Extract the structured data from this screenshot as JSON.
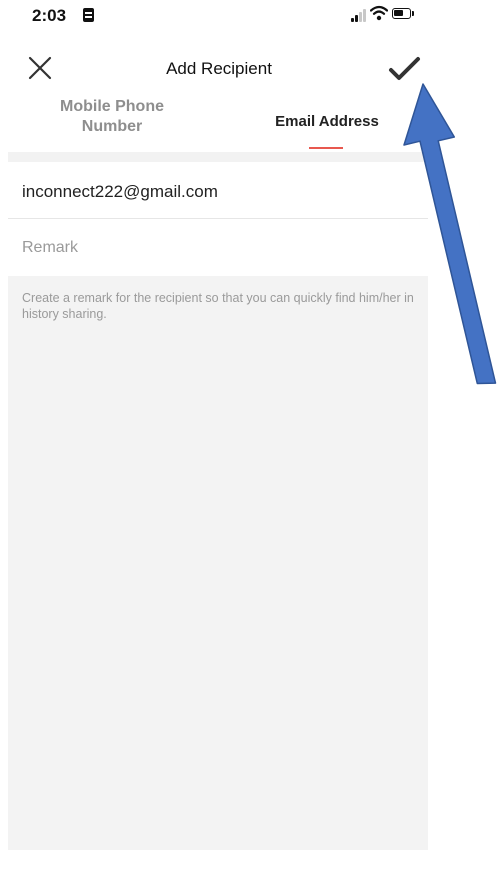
{
  "status_bar": {
    "time": "2:03"
  },
  "nav": {
    "title": "Add Recipient"
  },
  "tabs": [
    {
      "label": "Mobile Phone Number",
      "active": false
    },
    {
      "label": "Email Address",
      "active": true
    }
  ],
  "form": {
    "email_value": "inconnect222@gmail.com",
    "remark_placeholder": "Remark",
    "hint": "Create a remark for the recipient so that you can quickly find him/her in history sharing."
  },
  "colors": {
    "tab_indicator": "#e8584f",
    "annotation_arrow": "#4472c4"
  }
}
